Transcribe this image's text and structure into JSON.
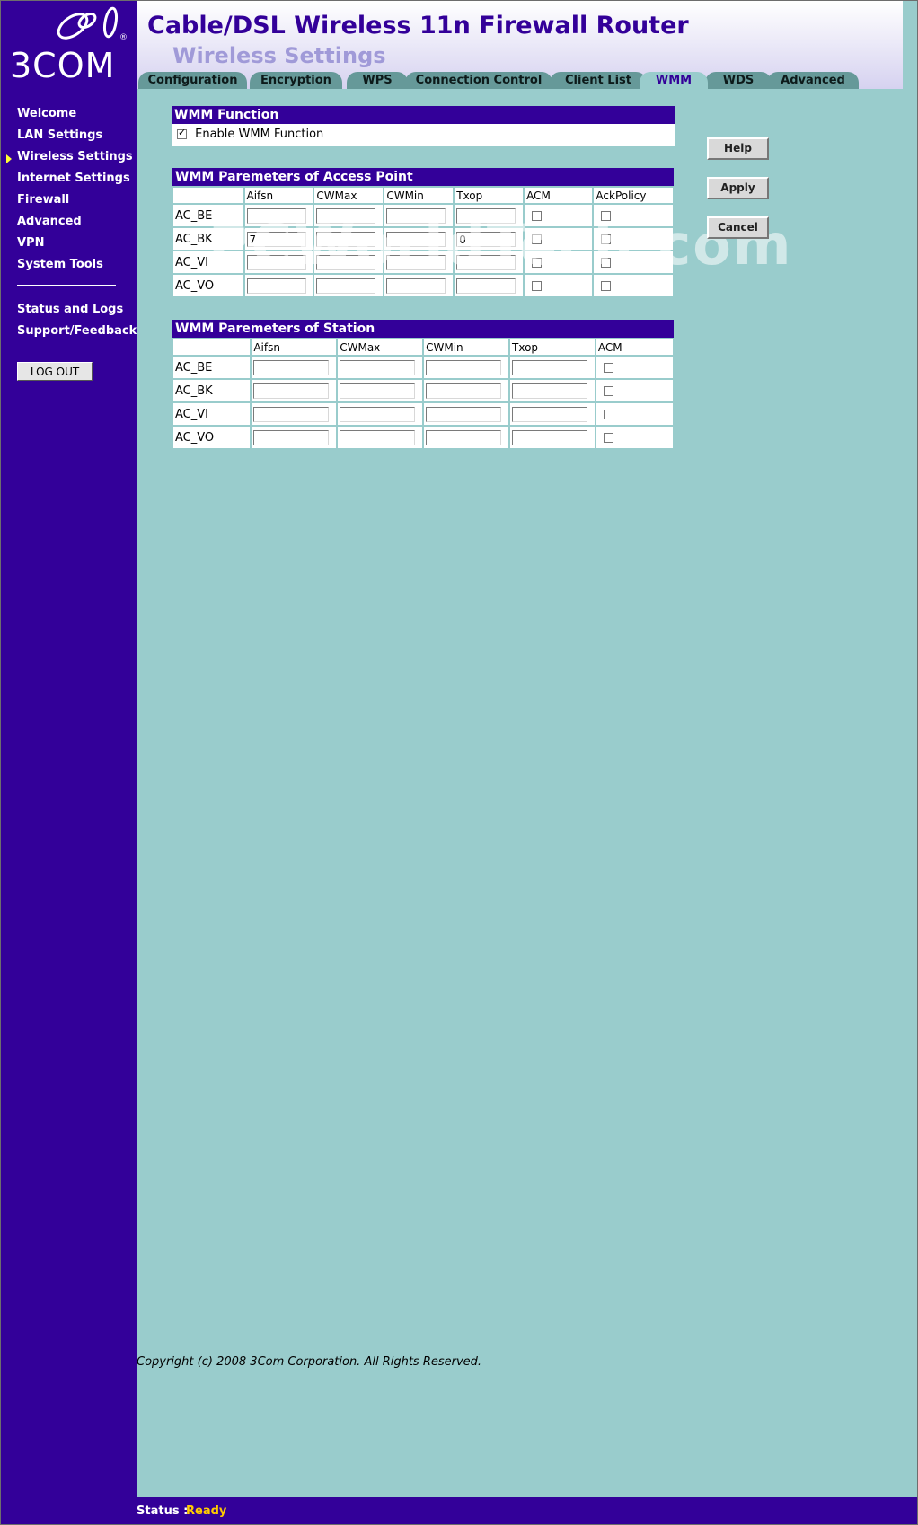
{
  "brand": {
    "logo_text": "3COM",
    "registered": "®"
  },
  "header": {
    "title": "Cable/DSL Wireless 11n Firewall Router",
    "subtitle": "Wireless Settings"
  },
  "tabs": [
    {
      "label": "Configuration"
    },
    {
      "label": "Encryption"
    },
    {
      "label": "WPS"
    },
    {
      "label": "Connection Control"
    },
    {
      "label": "Client List"
    },
    {
      "label": "WMM",
      "active": true
    },
    {
      "label": "WDS"
    },
    {
      "label": "Advanced"
    }
  ],
  "sidebar": {
    "items": [
      {
        "label": "Welcome"
      },
      {
        "label": "LAN Settings"
      },
      {
        "label": "Wireless Settings",
        "active": true
      },
      {
        "label": "Internet Settings"
      },
      {
        "label": "Firewall"
      },
      {
        "label": "Advanced"
      },
      {
        "label": "VPN"
      },
      {
        "label": "System Tools"
      }
    ],
    "secondary": [
      {
        "label": "Status and Logs"
      },
      {
        "label": "Support/Feedback"
      }
    ],
    "logout_label": "LOG OUT"
  },
  "wmm_function": {
    "title": "WMM Function",
    "enable_label": "Enable WMM Function",
    "enabled": true
  },
  "ap_params": {
    "title": "WMM Paremeters of Access Point",
    "columns": [
      "",
      "Aifsn",
      "CWMax",
      "CWMin",
      "Txop",
      "ACM",
      "AckPolicy"
    ],
    "rows": [
      {
        "name": "AC_BE",
        "aifsn": "",
        "cwmax": "",
        "cwmin": "",
        "txop": "",
        "acm": false,
        "ack": false
      },
      {
        "name": "AC_BK",
        "aifsn": "7",
        "cwmax": "",
        "cwmin": "",
        "txop": "0",
        "acm": false,
        "ack": false
      },
      {
        "name": "AC_VI",
        "aifsn": "",
        "cwmax": "",
        "cwmin": "",
        "txop": "",
        "acm": false,
        "ack": false
      },
      {
        "name": "AC_VO",
        "aifsn": "",
        "cwmax": "",
        "cwmin": "",
        "txop": "",
        "acm": false,
        "ack": false
      }
    ]
  },
  "sta_params": {
    "title": "WMM Paremeters of Station",
    "columns": [
      "",
      "Aifsn",
      "CWMax",
      "CWMin",
      "Txop",
      "ACM"
    ],
    "rows": [
      {
        "name": "AC_BE",
        "aifsn": "",
        "cwmax": "",
        "cwmin": "",
        "txop": "",
        "acm": false
      },
      {
        "name": "AC_BK",
        "aifsn": "",
        "cwmax": "",
        "cwmin": "",
        "txop": "",
        "acm": false
      },
      {
        "name": "AC_VI",
        "aifsn": "",
        "cwmax": "",
        "cwmin": "",
        "txop": "",
        "acm": false
      },
      {
        "name": "AC_VO",
        "aifsn": "",
        "cwmax": "",
        "cwmin": "",
        "txop": "",
        "acm": false
      }
    ]
  },
  "buttons": {
    "help": "Help",
    "apply": "Apply",
    "cancel": "Cancel"
  },
  "footer": {
    "copyright": "Copyright (c) 2008  3Com Corporation. All Rights Reserved.",
    "status_label": "Status :",
    "status_value": "Ready"
  },
  "watermark": "PCWorldTech.com",
  "colors": {
    "brand_purple": "#330099",
    "background": "#99cccc",
    "tab": "#669999",
    "status_value": "#ffcc00"
  }
}
